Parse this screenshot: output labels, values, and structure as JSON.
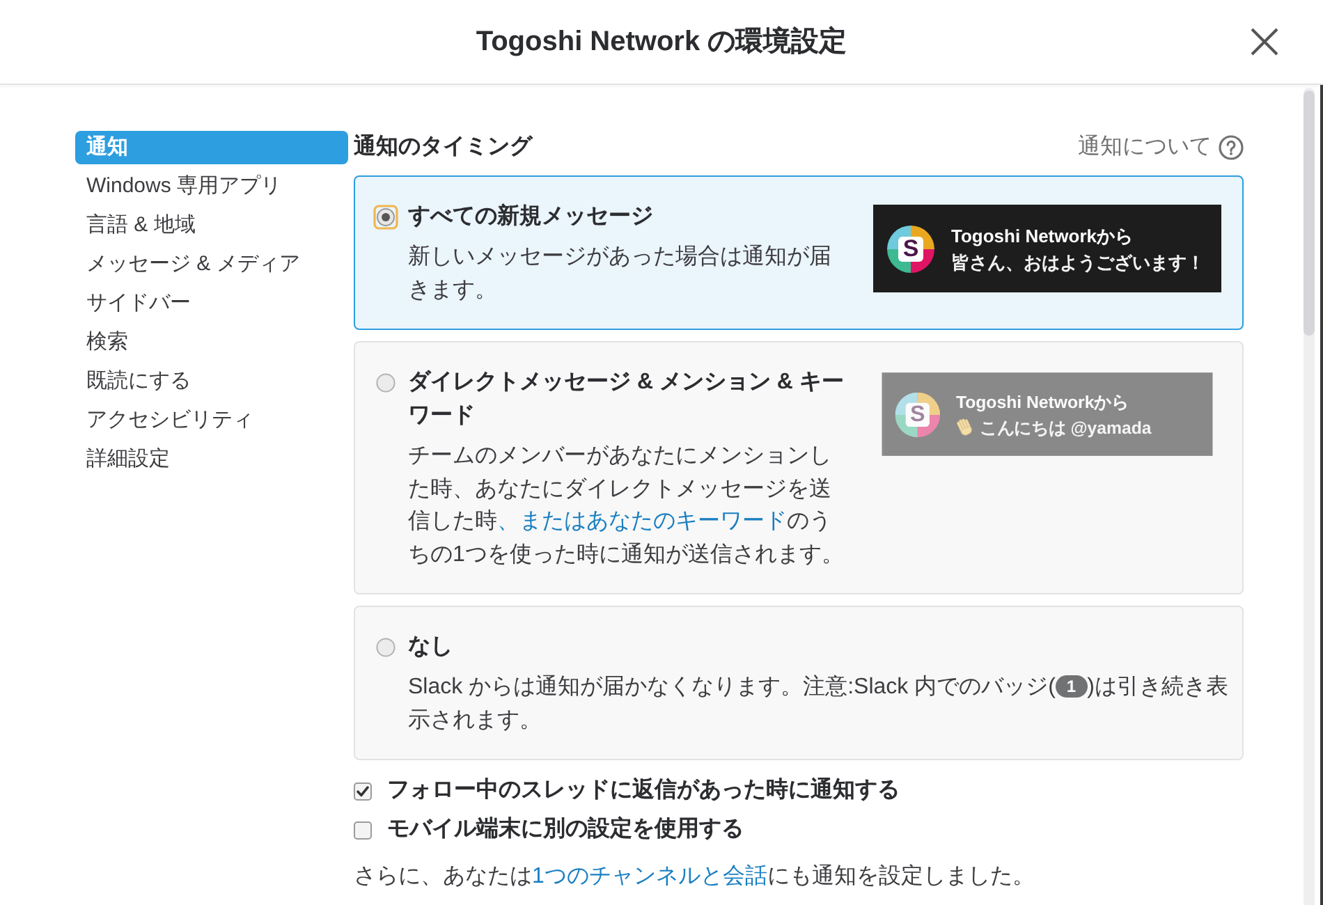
{
  "window": {
    "title": "Togoshi Network の環境設定"
  },
  "sidebar": {
    "items": [
      {
        "label": "通知",
        "selected": true
      },
      {
        "label": "Windows 専用アプリ",
        "selected": false
      },
      {
        "label": "言語 & 地域",
        "selected": false
      },
      {
        "label": "メッセージ & メディア",
        "selected": false
      },
      {
        "label": "サイドバー",
        "selected": false
      },
      {
        "label": "検索",
        "selected": false
      },
      {
        "label": "既読にする",
        "selected": false
      },
      {
        "label": "アクセシビリティ",
        "selected": false
      },
      {
        "label": "詳細設定",
        "selected": false
      }
    ]
  },
  "section": {
    "heading": "通知のタイミング",
    "help_link": "通知について"
  },
  "options": [
    {
      "title": "すべての新規メッセージ",
      "selected": true,
      "description": [
        {
          "kind": "text",
          "text": "新しいメッセージがあった場合は通知が届きます。"
        }
      ],
      "preview": {
        "kind": "plain",
        "logo_letter": "S",
        "sender": "Togoshi Networkから",
        "message": "皆さん、おはようございます！"
      }
    },
    {
      "title": "ダイレクトメッセージ & メンション & キーワード",
      "selected": false,
      "description": [
        {
          "kind": "text",
          "text": "チームのメンバーがあなたにメンションした時、あなたにダイレクトメッセージを送信した時"
        },
        {
          "kind": "link",
          "text": "、またはあなたのキーワード"
        },
        {
          "kind": "text",
          "text": "のうちの1つを使った時に通知が送信されます。"
        }
      ],
      "preview": {
        "kind": "wave",
        "logo_letter": "S",
        "sender": "Togoshi Networkから",
        "message": "こんにちは @yamada"
      }
    },
    {
      "title": "なし",
      "selected": false,
      "description": [
        {
          "kind": "text",
          "text": "Slack からは通知が届かなくなります。注意:Slack 内でのバッジ("
        },
        {
          "kind": "badge",
          "text": "1"
        },
        {
          "kind": "text",
          "text": ")は引き続き表示されます。"
        }
      ]
    }
  ],
  "checks": [
    {
      "label": "フォロー中のスレッドに返信があった時に通知する",
      "checked": true
    },
    {
      "label": "モバイル端末に別の設定を使用する",
      "checked": false
    }
  ],
  "footer": [
    {
      "kind": "text",
      "text": "さらに、あなたは"
    },
    {
      "kind": "link",
      "text": "1つのチャンネルと会話"
    },
    {
      "kind": "text",
      "text": "にも通知を設定しました。"
    }
  ]
}
